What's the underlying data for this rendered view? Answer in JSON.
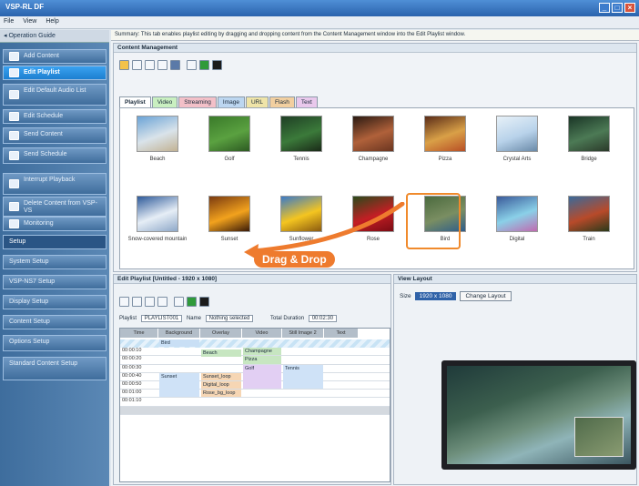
{
  "window": {
    "title": "VSP-RL DF"
  },
  "menu": [
    "File",
    "View",
    "Help"
  ],
  "nav": {
    "header": "Operation Guide",
    "items": [
      {
        "label": "Add Content",
        "active": false
      },
      {
        "label": "Edit Playlist",
        "active": true
      },
      {
        "label": "Edit Default Audio List",
        "active": false
      },
      {
        "label": "Edit Schedule",
        "active": false
      },
      {
        "label": "Send Content",
        "active": false
      },
      {
        "label": "Send Schedule",
        "active": false
      },
      {
        "label": "Interrupt Playback",
        "active": false
      },
      {
        "label": "Delete Content from VSP-VS",
        "active": false
      },
      {
        "label": "Monitoring",
        "active": false
      },
      {
        "label": "Setup",
        "active": false
      },
      {
        "label": "System Setup",
        "active": false
      },
      {
        "label": "VSP-NS7 Setup",
        "active": false
      },
      {
        "label": "Display Setup",
        "active": false
      },
      {
        "label": "Content Setup",
        "active": false
      },
      {
        "label": "Options Setup",
        "active": false
      },
      {
        "label": "Standard Content Setup",
        "active": false
      }
    ]
  },
  "guide_text": "Summary: This tab enables playlist editing by dragging and dropping content from the Content Management window into the Edit Playlist window.",
  "content_management": {
    "title": "Content Management",
    "tabs": [
      "Playlist",
      "Video",
      "Streaming",
      "Image",
      "URL",
      "Flash",
      "Text"
    ],
    "tab_colors": [
      "#ffffff",
      "#c9efc0",
      "#f3c0c8",
      "#bcd6f0",
      "#efe4a8",
      "#f2cfa0",
      "#e9c8ec"
    ],
    "thumbnails": [
      {
        "caption": "Beach",
        "colors": [
          "#6aa3d6",
          "#d9e3ea",
          "#c2b293"
        ]
      },
      {
        "caption": "Golf",
        "colors": [
          "#3a7a2a",
          "#5aa140",
          "#2d5a22"
        ]
      },
      {
        "caption": "Tennis",
        "colors": [
          "#1f3f25",
          "#3b7a3a",
          "#1a2a18"
        ]
      },
      {
        "caption": "Champagne",
        "colors": [
          "#2a1a12",
          "#b0613a",
          "#6a3520"
        ]
      },
      {
        "caption": "Pizza",
        "colors": [
          "#5a2c18",
          "#d9a047",
          "#b84f25"
        ]
      },
      {
        "caption": "Crystal Arts",
        "colors": [
          "#e7f1f8",
          "#b8d2ea",
          "#6a8aa8"
        ]
      },
      {
        "caption": "Bridge",
        "colors": [
          "#1a3526",
          "#4c7a55",
          "#2b3a2a"
        ]
      },
      {
        "caption": "Snow-covered mountain",
        "colors": [
          "#2e5a9a",
          "#e6eef6",
          "#8ea8c8"
        ]
      },
      {
        "caption": "Sunset",
        "colors": [
          "#7a3a10",
          "#f2a21d",
          "#3a1a08"
        ]
      },
      {
        "caption": "Sunflower",
        "colors": [
          "#3a7ac8",
          "#f4c520",
          "#8a5a10"
        ]
      },
      {
        "caption": "Rose",
        "colors": [
          "#2a4a1a",
          "#c41e24",
          "#7a0c14"
        ]
      },
      {
        "caption": "Bird",
        "colors": [
          "#4b6a3e",
          "#7a8e62",
          "#2e5d8a"
        ]
      },
      {
        "caption": "Digital",
        "colors": [
          "#3a5a9a",
          "#8ad0e8",
          "#c06ab0"
        ]
      },
      {
        "caption": "Train",
        "colors": [
          "#3a6a9a",
          "#b84a2a",
          "#2a3a1a"
        ]
      }
    ]
  },
  "drag_label": "Drag & Drop",
  "playlist_editor": {
    "title": "Edit Playlist [Untitled - 1920 x 1080]",
    "info_playlist_label": "Playlist",
    "info_playlist_value": "PLAYLIST001",
    "info_name_label": "Name",
    "info_name_value": "Nothing selected",
    "info_duration_label": "Total Duration",
    "info_duration_value": "00:02:30",
    "columns": [
      "Time",
      "Background",
      "Overlay",
      "Video",
      "Still Image 2",
      "Text"
    ],
    "times": [
      "00:00:00",
      "00:00:10",
      "00:00:20",
      "00:00:30",
      "00:00:40",
      "00:00:50",
      "00:01:00",
      "00:01:10",
      "00:01:20"
    ],
    "cells": [
      {
        "label": "Bird",
        "color": "#c9dff5"
      },
      {
        "label": "Beach",
        "color": "#c7e6c1"
      },
      {
        "label": "Champagne",
        "color": "#c7e6c1"
      },
      {
        "label": "Pizza",
        "color": "#c7e6c1"
      },
      {
        "label": "Golf",
        "color": "#e2cff3"
      },
      {
        "label": "Tennis",
        "color": "#cfe2f7"
      },
      {
        "label": "Sunset",
        "color": "#cfe2f7"
      },
      {
        "label": "Sunset_loop",
        "color": "#f6d6b4"
      },
      {
        "label": "Digital_loop",
        "color": "#f6d6b4"
      },
      {
        "label": "Rose_bg_loop",
        "color": "#f6d6b4"
      }
    ]
  },
  "view_layout": {
    "title": "View Layout",
    "size_label": "Size",
    "size_value": "1920 x 1080",
    "change_button": "Change Layout"
  }
}
